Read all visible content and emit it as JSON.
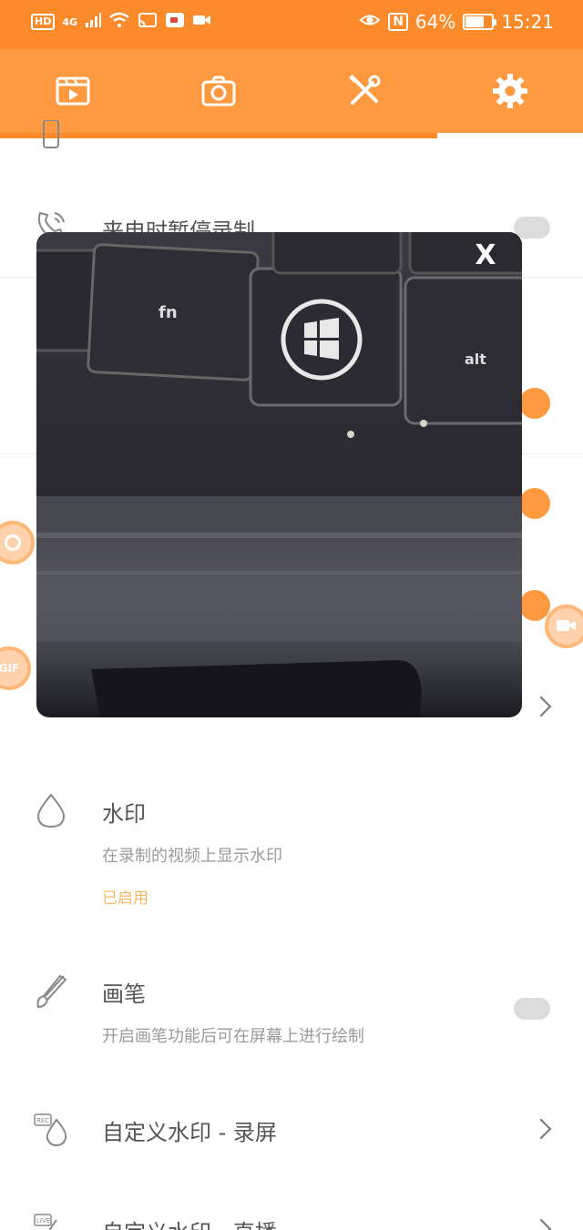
{
  "status_bar": {
    "hd_badge": "HD",
    "network": "4G",
    "nfc": "N",
    "battery_percent": "64%",
    "battery_level": 0.64,
    "time": "15:21"
  },
  "toolbar": {
    "tabs": [
      {
        "icon": "video-list-icon"
      },
      {
        "icon": "camera-icon"
      },
      {
        "icon": "tools-icon"
      },
      {
        "icon": "gear-icon",
        "active": true
      }
    ]
  },
  "settings": {
    "call_pause": {
      "title": "来电时暂停录制",
      "toggle": false
    },
    "watermark": {
      "title": "水印",
      "subtitle": "在录制的视频上显示水印",
      "status": "已启用"
    },
    "brush": {
      "title": "画笔",
      "subtitle": "开启画笔功能后可在屏幕上进行绘制",
      "toggle": false
    },
    "custom_watermark_record": {
      "title": "自定义水印 - 录屏"
    },
    "custom_watermark_live": {
      "title": "自定义水印 - 直播"
    }
  },
  "overlay": {
    "close_label": "X",
    "keyboard_keys": [
      "fn",
      "alt"
    ]
  },
  "floating": {
    "gif_label": "GIF"
  },
  "colors": {
    "accent": "#fd9a40",
    "status_bar": "#fb8a2a",
    "enabled_text": "#f3b867"
  }
}
